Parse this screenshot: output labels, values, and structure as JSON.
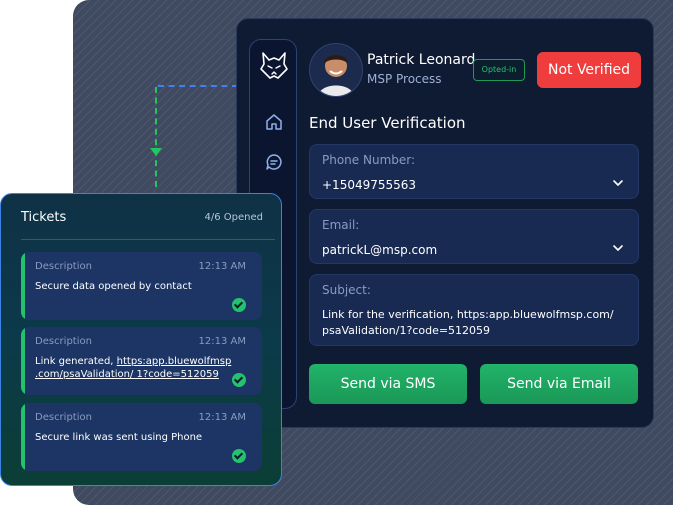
{
  "user": {
    "name": "Patrick Leonard",
    "role": "MSP Process",
    "opt_badge": "Opted-in",
    "status_button": "Not Verified"
  },
  "verification": {
    "title": "End User Verification",
    "phone": {
      "label": "Phone Number:",
      "value": "+15049755563"
    },
    "email": {
      "label": "Email:",
      "value": "patrickL@msp.com"
    },
    "subject": {
      "label": "Subject:",
      "value": "Link for the verification, https:app.bluewolfmsp.com/\npsaValidation/1?code=512059"
    },
    "send_sms_label": "Send via SMS",
    "send_email_label": "Send via Email"
  },
  "tickets": {
    "title": "Tickets",
    "count": "4/6 Opened",
    "items": [
      {
        "label": "Description",
        "time": "12:13 AM",
        "text": "Secure data opened by contact"
      },
      {
        "label": "Description",
        "time": "12:13 AM",
        "text_prefix": "Link generated, ",
        "link": "https:app.bluewolfmsp\n.com/psaValidation/ 1?code=512059"
      },
      {
        "label": "Description",
        "time": "12:13 AM",
        "text": "Secure link was sent using Phone"
      }
    ]
  },
  "icons": [
    "wolf-logo-icon",
    "home-icon",
    "chat-icon",
    "chevron-down-icon",
    "check-icon"
  ],
  "colors": {
    "accent_green": "#22b36a",
    "danger_red": "#ef3d3d",
    "card_bg": "#0f1a33"
  }
}
